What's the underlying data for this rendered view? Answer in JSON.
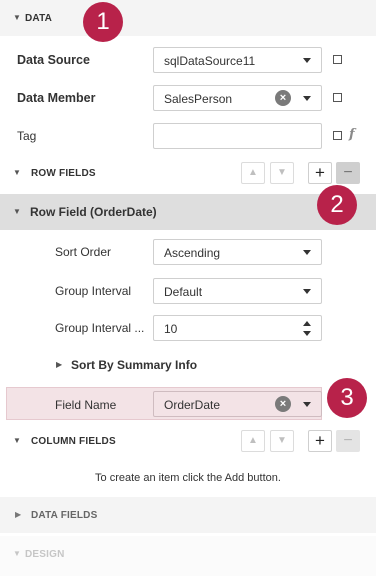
{
  "sections": {
    "data": "DATA",
    "row_fields": "ROW FIELDS",
    "row_field_item": "Row Field (OrderDate)",
    "sort_by_summary": "Sort By Summary Info",
    "column_fields": "COLUMN FIELDS",
    "data_fields": "DATA FIELDS",
    "design": "DESIGN"
  },
  "properties": {
    "data_source": {
      "label": "Data Source",
      "value": "sqlDataSource11"
    },
    "data_member": {
      "label": "Data Member",
      "value": "SalesPerson"
    },
    "tag": {
      "label": "Tag",
      "value": ""
    },
    "sort_order": {
      "label": "Sort Order",
      "value": "Ascending"
    },
    "group_interval": {
      "label": "Group Interval",
      "value": "Default"
    },
    "group_interval_num": {
      "label": "Group Interval ...",
      "value": "10"
    },
    "field_name": {
      "label": "Field Name",
      "value": "OrderDate"
    }
  },
  "column_fields_empty": "To create an item click the Add button.",
  "buttons": {
    "plus": "+",
    "minus": "−",
    "clear": "×",
    "fx": "f"
  },
  "badges": [
    "1",
    "2",
    "3"
  ],
  "colors": {
    "badge": "#b8224a",
    "field_highlight": "#f3e3e6",
    "selected_header": "#dedede"
  }
}
